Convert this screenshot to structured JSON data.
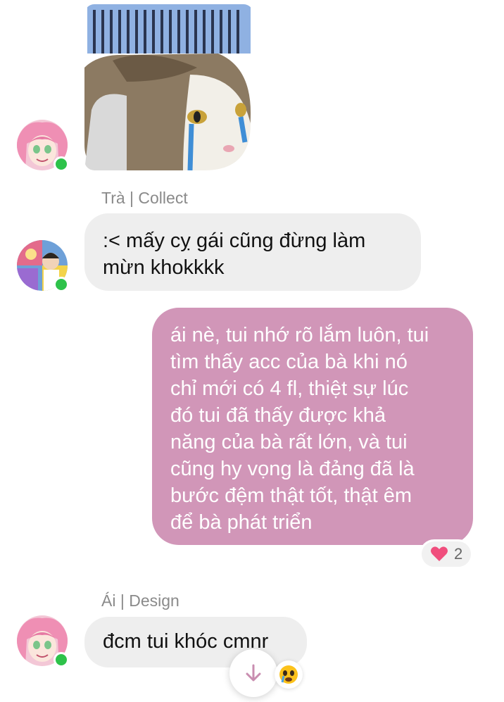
{
  "messages": {
    "sticker": {
      "icon": "crying-cat-sticker"
    },
    "msg1": {
      "sender": "Trà | Collect",
      "text_line1": ":< mấy cỵ gái cũng đừng làm",
      "text_line2": "mừn khokkkk"
    },
    "msg2": {
      "lines": [
        "ái nè, tui nhớ rõ lắm luôn, tui",
        "tìm thấy acc của bà khi nó",
        "chỉ mới có 4 fl, thiệt sự lúc",
        "đó tui đã thấy được khả",
        "năng của bà rất lớn, và tui",
        "cũng hy vọng là đảng đã là",
        "bước đệm thật tốt, thật êm",
        "để bà phát triển"
      ],
      "reaction_count": "2"
    },
    "msg3": {
      "sender": "Ái | Design",
      "text": "đcm tui khóc cmnr"
    }
  },
  "colors": {
    "outgoing_bubble": "#d196b8",
    "incoming_bubble": "#eeeeee",
    "online": "#2ec24a",
    "scroll_arrow": "#c98db0"
  },
  "icons": {
    "scroll": "arrow-down-icon",
    "reaction": "heart-icon",
    "emoji": "crying-face-icon"
  }
}
